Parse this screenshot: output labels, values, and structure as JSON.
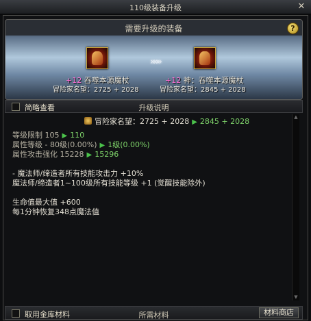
{
  "window": {
    "title": "110级装备升级",
    "close_glyph": "✕"
  },
  "header": {
    "title": "需要升级的装备",
    "help_glyph": "?",
    "arrows": "»»»",
    "from": {
      "plus": "+12",
      "name": "吞噬本源魔杖",
      "reputation": "冒险家名望：2725 + 2028"
    },
    "to": {
      "plus": "+12",
      "name": "神：吞噬本源魔杖",
      "reputation": "冒险家名望：2845 + 2028"
    }
  },
  "options_bar": {
    "checkbox_label": "简略查看",
    "section_title": "升级说明"
  },
  "details": {
    "reputation_label": "冒险家名望：",
    "reputation_from": "2725 + 2028",
    "reputation_to": "2845 + 2028",
    "arrow": "▶",
    "stats": [
      {
        "label": "等级限制",
        "from": "105",
        "to": "110"
      },
      {
        "label": "属性等级",
        "from": "- 80级(0.00%)",
        "to": "1级(0.00%)"
      },
      {
        "label": "属性攻击强化",
        "from": "15228",
        "to": "15296"
      }
    ],
    "effects": [
      "- 魔法师/缔造者所有技能攻击力 +10%",
      "魔法师/缔造者1~100级所有技能等级 +1 (觉醒技能除外)",
      "",
      "生命值最大值 +600",
      "每1分钟恢复348点魔法值"
    ]
  },
  "bottom_bar": {
    "checkbox_label": "取用金库材料",
    "section_title": "所需材料",
    "shop_button": "材料商店"
  },
  "scrollbar": {
    "up_glyph": "▲",
    "down_glyph": "▼"
  }
}
